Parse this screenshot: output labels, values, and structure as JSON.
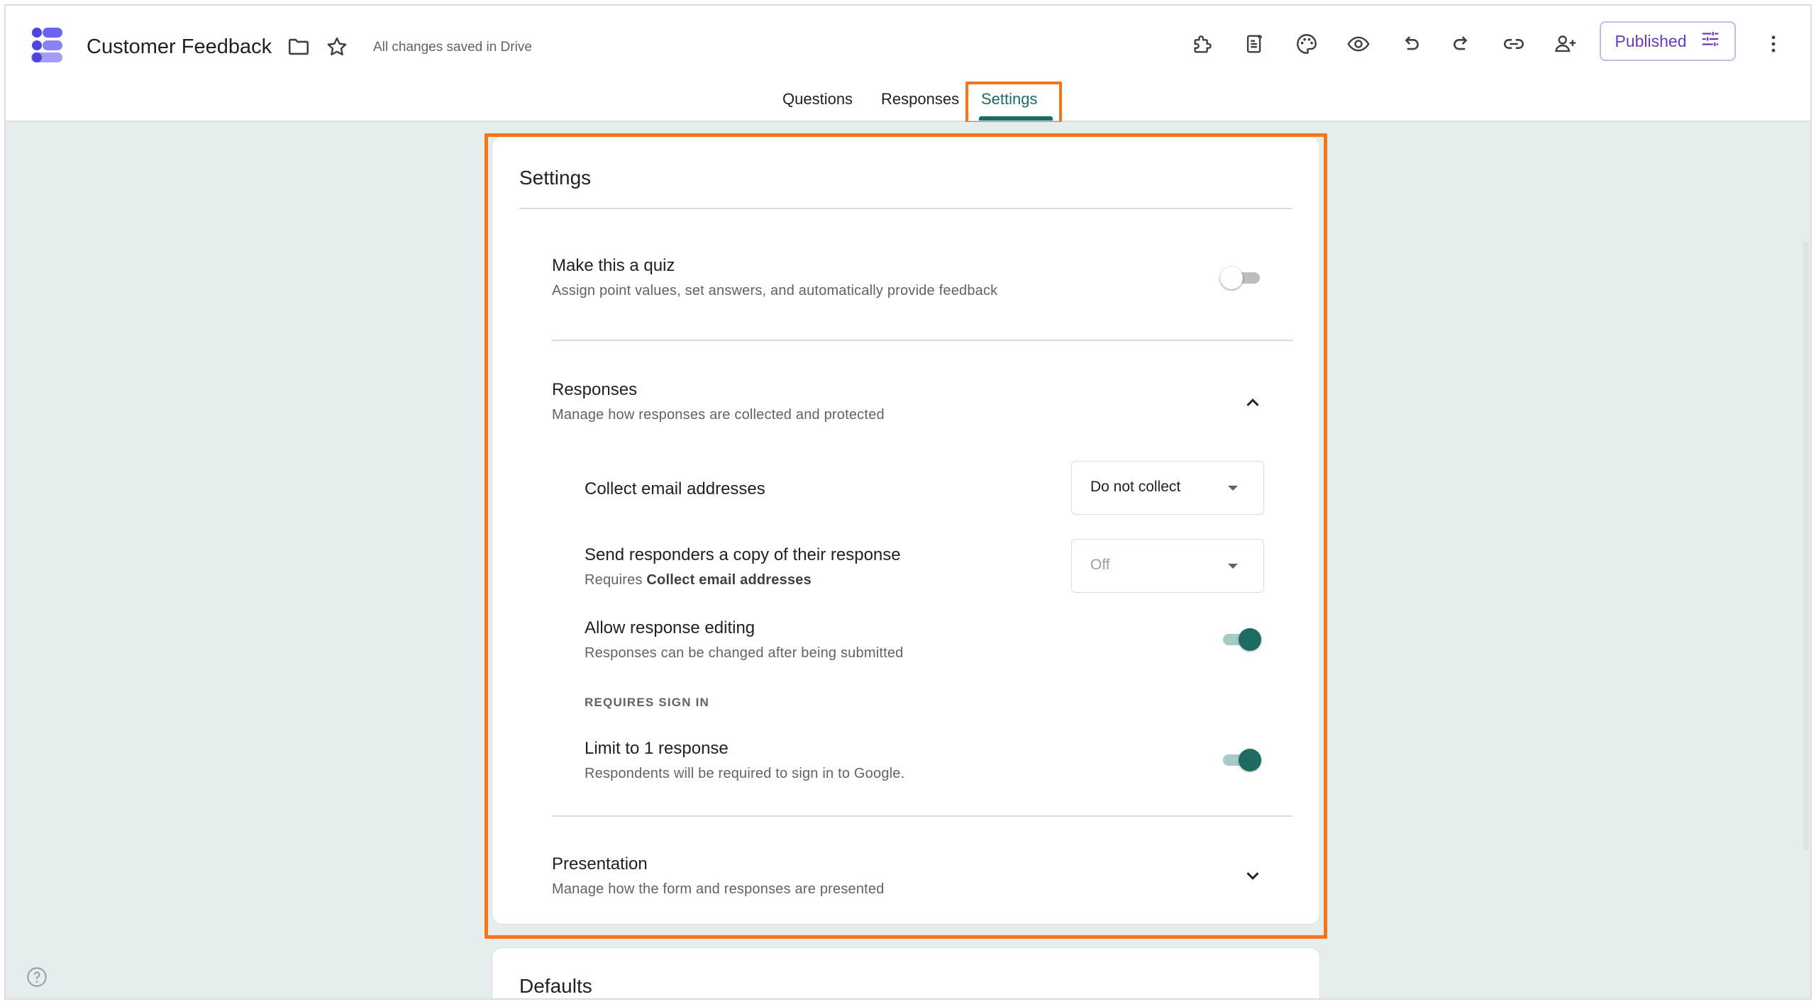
{
  "header": {
    "title": "Customer Feedback",
    "save_status": "All changes saved in Drive",
    "publish_label": "Published"
  },
  "tabs": [
    {
      "label": "Questions"
    },
    {
      "label": "Responses"
    },
    {
      "label": "Settings"
    }
  ],
  "settings": {
    "card_title": "Settings",
    "quiz": {
      "title": "Make this a quiz",
      "subtitle": "Assign point values, set answers, and automatically provide feedback",
      "enabled": false
    },
    "responses": {
      "title": "Responses",
      "subtitle": "Manage how responses are collected and protected",
      "collect_email": {
        "label": "Collect email addresses",
        "value": "Do not collect"
      },
      "send_copy": {
        "label": "Send responders a copy of their response",
        "requires_prefix": "Requires",
        "requires_bold": "Collect email addresses",
        "value": "Off"
      },
      "allow_editing": {
        "label": "Allow response editing",
        "subtitle": "Responses can be changed after being submitted",
        "enabled": true
      },
      "requires_sign_in": "REQUIRES SIGN IN",
      "limit_one": {
        "label": "Limit to 1 response",
        "subtitle": "Respondents will be required to sign in to Google.",
        "enabled": true
      }
    },
    "presentation": {
      "title": "Presentation",
      "subtitle": "Manage how the form and responses are presented"
    }
  },
  "defaults": {
    "title": "Defaults"
  },
  "colors": {
    "accent": "#1e6b63",
    "publish": "#673ab7",
    "background": "#e5eeec",
    "highlight": "#fb7415"
  },
  "icons": [
    "forms-logo-icon",
    "folder-icon",
    "star-icon",
    "addon-icon",
    "import-questions-icon",
    "palette-icon",
    "preview-eye-icon",
    "undo-icon",
    "redo-icon",
    "link-icon",
    "add-collaborator-icon",
    "publish-options-icon",
    "more-vert-icon",
    "chevron-up-icon",
    "chevron-down-icon",
    "help-icon"
  ]
}
